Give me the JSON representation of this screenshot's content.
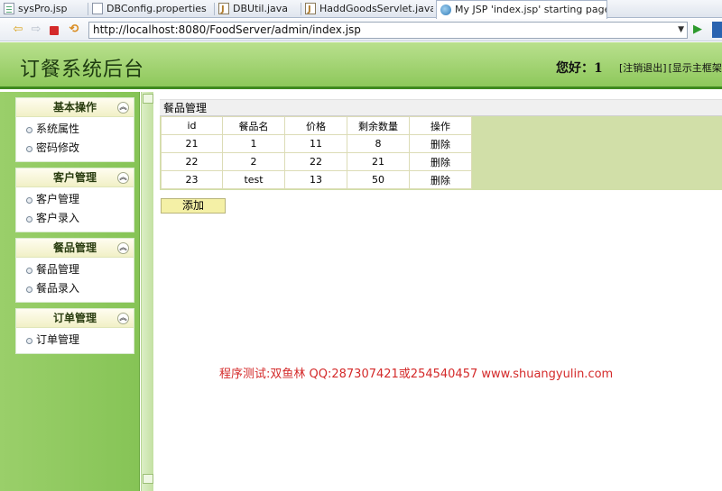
{
  "browser": {
    "tabs": [
      {
        "label": "sysPro.jsp",
        "icon": "jsp-file-icon"
      },
      {
        "label": "DBConfig.properties",
        "icon": "properties-file-icon"
      },
      {
        "label": "DBUtil.java",
        "icon": "java-file-icon"
      },
      {
        "label": "HaddGoodsServlet.java",
        "icon": "java-file-icon"
      },
      {
        "label": "My JSP 'index.jsp' starting page",
        "icon": "globe-icon",
        "active": true
      }
    ],
    "url": "http://localhost:8080/FoodServer/admin/index.jsp"
  },
  "header": {
    "title": "订餐系统后台",
    "greeting": "您好：1",
    "links": [
      "[注销退出]",
      "[显示主框架"
    ]
  },
  "sidebar": {
    "groups": [
      {
        "title": "基本操作",
        "items": [
          "系统属性",
          "密码修改"
        ]
      },
      {
        "title": "客户管理",
        "items": [
          "客户管理",
          "客户录入"
        ]
      },
      {
        "title": "餐品管理",
        "items": [
          "餐品管理",
          "餐品录入"
        ]
      },
      {
        "title": "订单管理",
        "items": [
          "订单管理"
        ]
      }
    ]
  },
  "main": {
    "panel_title": "餐品管理",
    "columns": [
      "id",
      "餐品名",
      "价格",
      "剩余数量",
      "操作"
    ],
    "rows": [
      {
        "id": "21",
        "name": "1",
        "price": "11",
        "stock": "8",
        "action": "删除"
      },
      {
        "id": "22",
        "name": "2",
        "price": "22",
        "stock": "21",
        "action": "删除"
      },
      {
        "id": "23",
        "name": "test",
        "price": "13",
        "stock": "50",
        "action": "删除"
      }
    ],
    "add_label": "添加",
    "watermark": "程序测试:双鱼林 QQ:287307421或254540457 www.shuangyulin.com"
  },
  "colors": {
    "header_green": "#8ec85b",
    "sidebar_green": "#86c456",
    "watermark_red": "#d42a2a"
  }
}
